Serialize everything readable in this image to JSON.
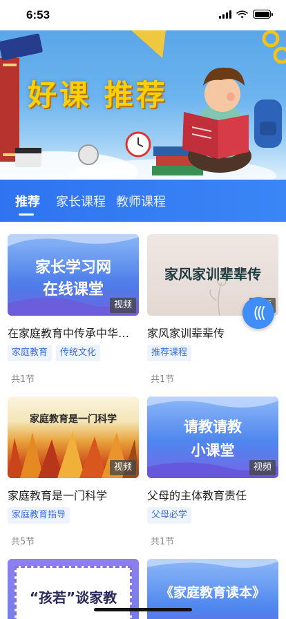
{
  "status": {
    "time": "6:53"
  },
  "banner": {
    "title": "好课  推荐"
  },
  "tabs": [
    {
      "label": "推荐",
      "active": true
    },
    {
      "label": "家长课程",
      "active": false
    },
    {
      "label": "教师课程",
      "active": false
    }
  ],
  "courses": [
    {
      "thumb_text": [
        "家长学习网",
        "在线课堂"
      ],
      "badge": "视频",
      "title": "在家庭教育中传承中华传统美德",
      "tags": [
        "家庭教育",
        "传统文化"
      ],
      "lessons": "共1节"
    },
    {
      "thumb_text": [
        "家风家训辈辈传"
      ],
      "badge": "视频",
      "title": "家风家训辈辈传",
      "tags": [
        "推荐课程"
      ],
      "lessons": "共1节"
    },
    {
      "thumb_text": [
        "家庭教育是一门科学"
      ],
      "badge": "视频",
      "title": "家庭教育是一门科学",
      "tags": [
        "家庭教育指导"
      ],
      "lessons": "共5节"
    },
    {
      "thumb_text": [
        "请教请教",
        "小课堂"
      ],
      "badge": "视频",
      "title": "父母的主体教育责任",
      "tags": [
        "父母必学"
      ],
      "lessons": "共1节"
    },
    {
      "thumb_text": [
        "“孩若”谈家教"
      ]
    },
    {
      "thumb_text": [
        "《家庭教育读本》"
      ]
    }
  ],
  "icons": {
    "float_button": "chevrons-left-icon",
    "signal": "signal-icon",
    "wifi": "wifi-icon",
    "battery": "battery-icon"
  },
  "colors": {
    "primary": "#3a86f6",
    "tag_bg": "#eef4ff",
    "tag_text": "#3b6fd6"
  }
}
